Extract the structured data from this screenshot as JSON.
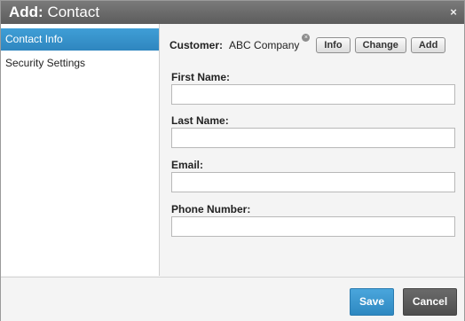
{
  "dialog": {
    "title_strong": "Add:",
    "title_rest": "Contact",
    "close_glyph": "×"
  },
  "sidebar": {
    "items": [
      {
        "label": "Contact Info",
        "active": true
      },
      {
        "label": "Security Settings",
        "active": false
      }
    ]
  },
  "customer": {
    "label": "Customer:",
    "value": "ABC Company",
    "remove_glyph": "×",
    "buttons": {
      "info": "Info",
      "change": "Change",
      "add": "Add"
    }
  },
  "fields": {
    "first_name": {
      "label": "First Name:",
      "value": ""
    },
    "last_name": {
      "label": "Last Name:",
      "value": ""
    },
    "email": {
      "label": "Email:",
      "value": ""
    },
    "phone": {
      "label": "Phone Number:",
      "value": ""
    }
  },
  "footer": {
    "save_label": "Save",
    "cancel_label": "Cancel"
  },
  "colors": {
    "accent": "#3a97d1",
    "titlebar": "#6b6b6b",
    "cancel": "#5a5a5a"
  }
}
